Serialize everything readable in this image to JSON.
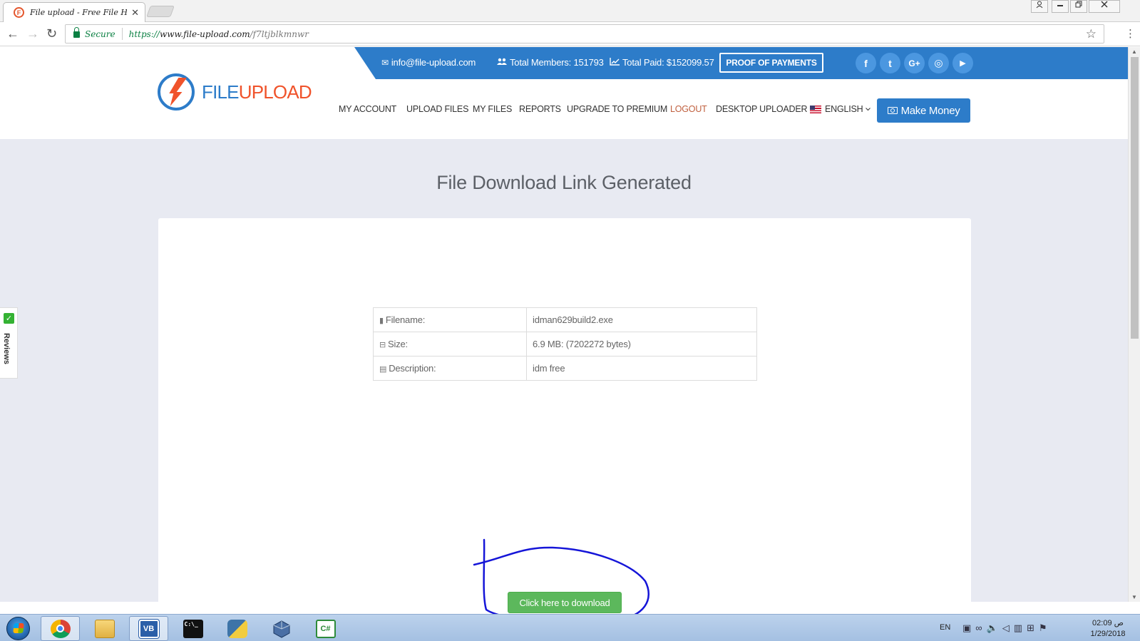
{
  "browser": {
    "tab_title": "File upload - Free File H",
    "tab_favicon": "F",
    "tab_close": "✕",
    "back_icon": "←",
    "forward_icon": "→",
    "reload_icon": "↻",
    "secure_label": "Secure",
    "url_scheme": "https://",
    "url_host": "www.file-upload.com",
    "url_path": "/f7ltjblkmnwr",
    "bookmark_icon": "☆",
    "menu_icon": "⋮"
  },
  "topbar": {
    "email": "info@file-upload.com",
    "members": "Total Members: 151793",
    "paid": "Total Paid: $152099.57",
    "proof_button": "PROOF OF PAYMENTS",
    "social": [
      "f",
      "t",
      "G+",
      "◎",
      "▶"
    ],
    "accent_color": "#2d7cc9"
  },
  "logo": {
    "part1": "FILE",
    "part2": "UPLOAD"
  },
  "nav": {
    "items": [
      "MY ACCOUNT",
      "UPLOAD FILES",
      "MY FILES",
      "REPORTS",
      "UPGRADE TO PREMIUM",
      "LOGOUT",
      "DESKTOP UPLOADER"
    ],
    "language": "ENGLISH",
    "make_money": "Make Money"
  },
  "page": {
    "heading": "File Download Link Generated",
    "file_info": [
      {
        "label": "Filename:",
        "value": "idman629build2.exe",
        "icon": "file-icon"
      },
      {
        "label": "Size:",
        "value": "6.9 MB: (7202272 bytes)",
        "icon": "drive-icon"
      },
      {
        "label": "Description:",
        "value": "idm free",
        "icon": "document-icon"
      }
    ],
    "download_button": "Click here to download",
    "download_color": "#5cb85c"
  },
  "reviews_tab": {
    "label": "Reviews"
  },
  "taskbar": {
    "apps": [
      "chrome",
      "explorer",
      "VB",
      "cmd",
      "python",
      "virtualbox",
      "C#"
    ],
    "apps_labels": {
      "vb": "VB",
      "cmd": "C:\\_",
      "csharp": "C#"
    },
    "language": "EN",
    "time": "02:09 ص",
    "date": "1/29/2018"
  }
}
